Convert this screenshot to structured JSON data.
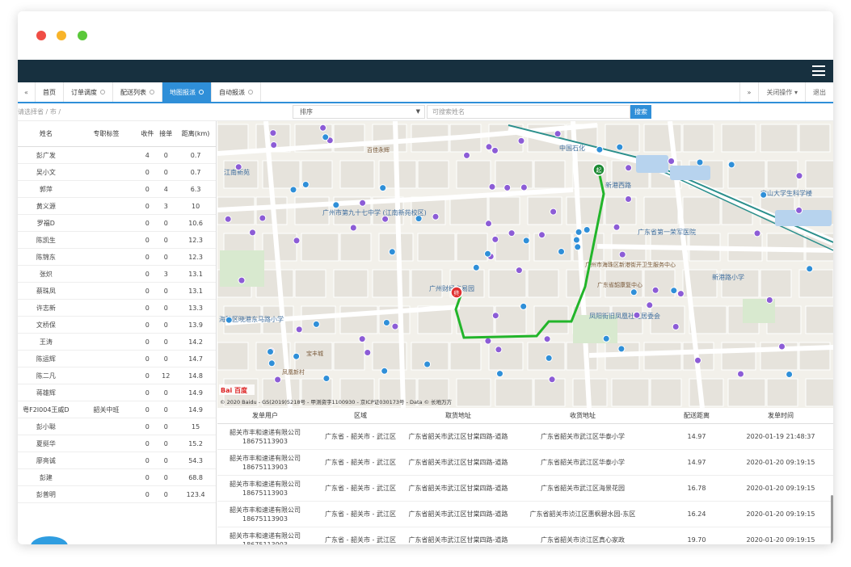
{
  "tabs": {
    "prev_icon": "double-left-arrow",
    "items": [
      {
        "label": "首页",
        "closable": false,
        "active": false
      },
      {
        "label": "订单调度",
        "closable": true,
        "active": false
      },
      {
        "label": "配送列表",
        "closable": true,
        "active": false
      },
      {
        "label": "地图报派",
        "closable": true,
        "active": true
      },
      {
        "label": "自动报派",
        "closable": true,
        "active": false
      }
    ],
    "next_icon": "double-right-arrow",
    "close_ops_label": "关闭操作",
    "logout_label": "退出"
  },
  "filters": {
    "region_placeholder": "请选择省 / 市 / 区",
    "sort_value": "排序",
    "name_placeholder": "可搜索姓名",
    "search_label": "搜索"
  },
  "couriers": {
    "headers": {
      "name": "姓名",
      "tag": "专职标签",
      "received": "收件",
      "accepted": "接单",
      "distance": "距离(km)"
    },
    "rows": [
      {
        "name": "彭广发",
        "tag": "",
        "received": "4",
        "accepted": "0",
        "distance": "0.7"
      },
      {
        "name": "吴小文",
        "tag": "",
        "received": "0",
        "accepted": "0",
        "distance": "0.7"
      },
      {
        "name": "郭萍",
        "tag": "",
        "received": "0",
        "accepted": "4",
        "distance": "6.3"
      },
      {
        "name": "黄义源",
        "tag": "",
        "received": "0",
        "accepted": "3",
        "distance": "10"
      },
      {
        "name": "罗福D",
        "tag": "",
        "received": "0",
        "accepted": "0",
        "distance": "10.6"
      },
      {
        "name": "陈凯生",
        "tag": "",
        "received": "0",
        "accepted": "0",
        "distance": "12.3"
      },
      {
        "name": "陈锦东",
        "tag": "",
        "received": "0",
        "accepted": "0",
        "distance": "12.3"
      },
      {
        "name": "张炽",
        "tag": "",
        "received": "0",
        "accepted": "3",
        "distance": "13.1"
      },
      {
        "name": "蔡珠凤",
        "tag": "",
        "received": "0",
        "accepted": "0",
        "distance": "13.1"
      },
      {
        "name": "许志新",
        "tag": "",
        "received": "0",
        "accepted": "0",
        "distance": "13.3"
      },
      {
        "name": "文桥保",
        "tag": "",
        "received": "0",
        "accepted": "0",
        "distance": "13.9"
      },
      {
        "name": "王涛",
        "tag": "",
        "received": "0",
        "accepted": "0",
        "distance": "14.2"
      },
      {
        "name": "陈运辉",
        "tag": "",
        "received": "0",
        "accepted": "0",
        "distance": "14.7"
      },
      {
        "name": "陈二凡",
        "tag": "",
        "received": "0",
        "accepted": "12",
        "distance": "14.8"
      },
      {
        "name": "蒋雄辉",
        "tag": "",
        "received": "0",
        "accepted": "0",
        "distance": "14.9"
      },
      {
        "name": "粤F2I004王威D",
        "tag": "韶关中班",
        "received": "0",
        "accepted": "0",
        "distance": "14.9"
      },
      {
        "name": "彭小聪",
        "tag": "",
        "received": "0",
        "accepted": "0",
        "distance": "15"
      },
      {
        "name": "夏挺华",
        "tag": "",
        "received": "0",
        "accepted": "0",
        "distance": "15.2"
      },
      {
        "name": "廖亮诚",
        "tag": "",
        "received": "0",
        "accepted": "0",
        "distance": "54.3"
      },
      {
        "name": "彭建",
        "tag": "",
        "received": "0",
        "accepted": "0",
        "distance": "68.8"
      },
      {
        "name": "彭普明",
        "tag": "",
        "received": "0",
        "accepted": "0",
        "distance": "123.4"
      }
    ]
  },
  "map": {
    "labels": [
      "广州市第九十七中学 (江南新苑校区)",
      "广州财经交易园",
      "江南新苑",
      "中国石化",
      "广东省第一荣军医院",
      "新港路小学",
      "海珠区晓港东马路小学",
      "凤阳街旧凤凰社区居委会",
      "中山大学生科学楼",
      "新港西路",
      "百佳永辉",
      "广州市海珠区新港街开卫生服务中心",
      "广东省韶康复中心",
      "宝丰城",
      "凤凰新村"
    ],
    "attribution": "© 2020 Baidu - GS(2019)5218号 - 甲测资字1100930 - 京ICP证030173号 - Data © 长地万方",
    "logo_text": "Bai 百度",
    "start_marker": "起",
    "end_marker": "终",
    "route_color": "#22b52a"
  },
  "orders": {
    "headers": {
      "sender": "发单用户",
      "region": "区域",
      "pickup": "取货地址",
      "delivery": "收货地址",
      "distance": "配送距离",
      "time": "发单时间"
    },
    "rows": [
      {
        "company": "韶关市丰和速递有限公司",
        "phone": "18675113903",
        "region": "广东省 - 韶关市 - 武江区",
        "pickup": "广东省韶关市武江区甘棠四路-道路",
        "delivery": "广东省韶关市武江区华泰小学",
        "distance": "14.97",
        "time": "2020-01-19 21:48:37"
      },
      {
        "company": "韶关市丰和速递有限公司",
        "phone": "18675113903",
        "region": "广东省 - 韶关市 - 武江区",
        "pickup": "广东省韶关市武江区甘棠四路-道路",
        "delivery": "广东省韶关市武江区华泰小学",
        "distance": "14.97",
        "time": "2020-01-20 09:19:15"
      },
      {
        "company": "韶关市丰和速递有限公司",
        "phone": "18675113903",
        "region": "广东省 - 韶关市 - 武江区",
        "pickup": "广东省韶关市武江区甘棠四路-道路",
        "delivery": "广东省韶关市武江区海景花园",
        "distance": "16.78",
        "time": "2020-01-20 09:19:15"
      },
      {
        "company": "韶关市丰和速递有限公司",
        "phone": "18675113903",
        "region": "广东省 - 韶关市 - 武江区",
        "pickup": "广东省韶关市武江区甘棠四路-道路",
        "delivery": "广东省韶关市浈江区惠枫碧水园-东区",
        "distance": "16.24",
        "time": "2020-01-20 09:19:15"
      },
      {
        "company": "韶关市丰和速递有限公司",
        "phone": "18675113903",
        "region": "广东省 - 韶关市 - 武江区",
        "pickup": "广东省韶关市武江区甘棠四路-道路",
        "delivery": "广东省韶关市浈江区真心家政",
        "distance": "19.70",
        "time": "2020-01-20 09:19:15"
      }
    ]
  }
}
